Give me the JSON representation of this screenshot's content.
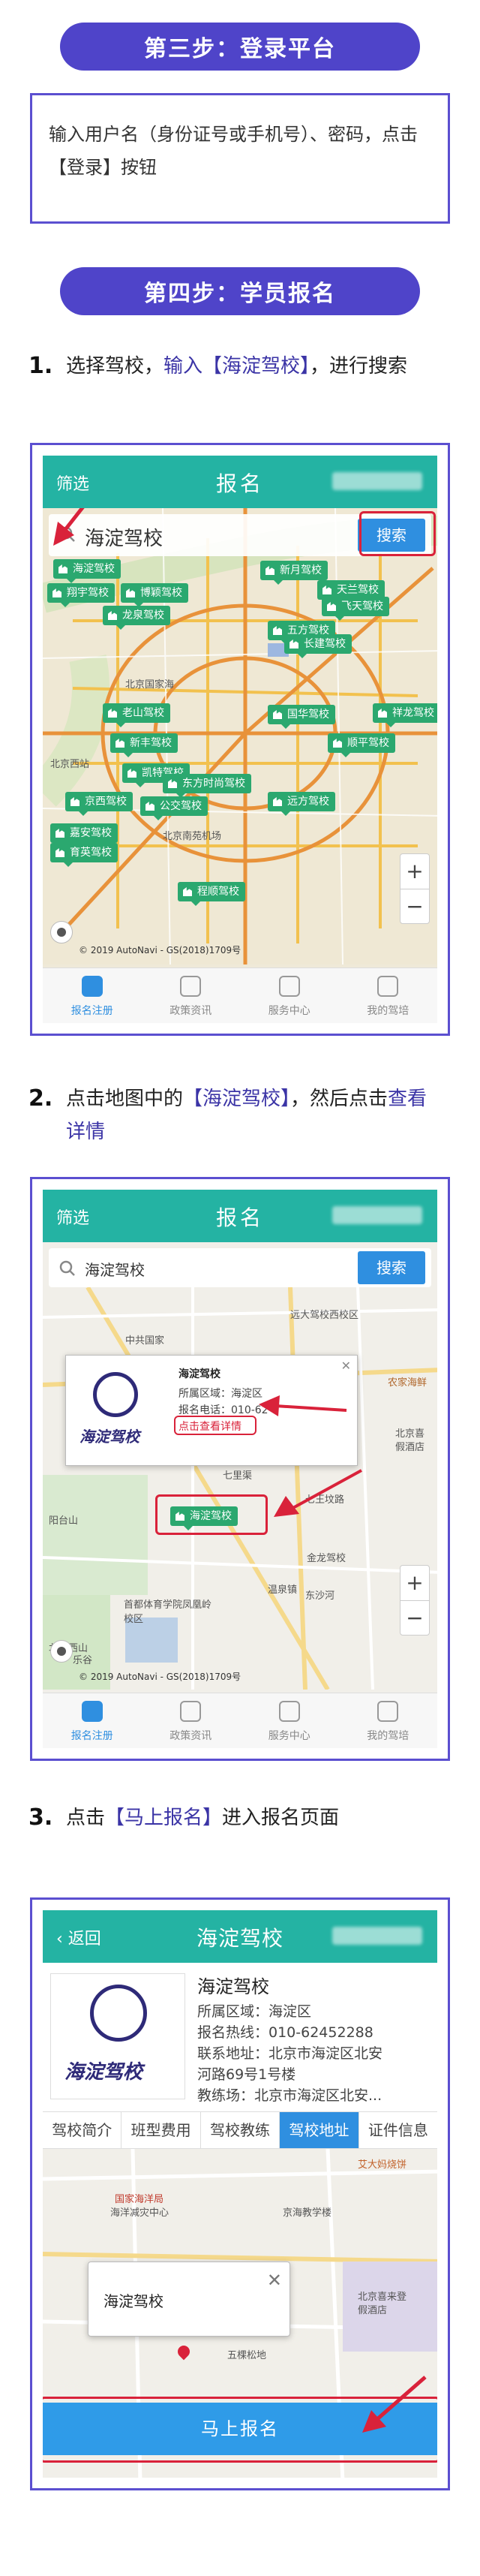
{
  "step3": {
    "title": "第三步：登录平台",
    "instruction": "输入用户名（身份证号或手机号）、密码，点击【登录】按钮"
  },
  "step4": {
    "title": "第四步：学员报名",
    "sub1": {
      "num": "1.",
      "pre": "选择驾校，",
      "hl": "输入【海淀驾校】",
      "post": "，进行搜索"
    },
    "sub2": {
      "num": "2.",
      "pre": "点击地图中的",
      "hl1": "【海淀驾校】",
      "mid": "，然后点击",
      "hl2": "查看详情"
    },
    "sub3": {
      "num": "3.",
      "pre": "点击",
      "hl": "【马上报名】",
      "post": "进入报名页面"
    }
  },
  "app": {
    "filter": "筛选",
    "title": "报名",
    "search_value": "海淀驾校",
    "search_button": "搜索",
    "copyright": "© 2019 AutoNavi - GS(2018)1709号",
    "nav": [
      "报名注册",
      "政策资讯",
      "服务中心",
      "我的驾培"
    ]
  },
  "map1": {
    "tags": [
      "海淀驾校",
      "翔宇驾校",
      "博颖驾校",
      "龙泉驾校",
      "老山驾校",
      "新丰驾校",
      "凯特驾校",
      "公交驾校",
      "东方时尚驾校",
      "京西驾校",
      "嘉安驾校",
      "育英驾校",
      "远方驾校",
      "程顺驾校",
      "新月驾校",
      "天兰驾校",
      "飞天驾校",
      "五方驾校",
      "长建驾校",
      "顺平驾校",
      "国华驾校",
      "祥龙驾校"
    ],
    "labels": [
      "北京国家海",
      "北京西站",
      "北京南苑机场"
    ]
  },
  "map2": {
    "labels": [
      "远大驾校西校区",
      "中共国家",
      "农家海鲜",
      "北京喜",
      "假酒店",
      "七里渠",
      "七王坟路",
      "金龙驾校",
      "首都体育学院凤凰岭校区",
      "北京西山",
      "乐谷",
      "阳台山",
      "温泉镇",
      "东沙河"
    ],
    "popup": {
      "name": "海淀驾校",
      "area": "所属区域：海淀区",
      "phone": "报名电话：010-62",
      "detail": "点击查看详情",
      "logo": "海淀驾校"
    },
    "tag": "海淀驾校"
  },
  "detail": {
    "back": "返回",
    "title": "海淀驾校",
    "name": "海淀驾校",
    "area": "所属区域：海淀区",
    "hotline": "报名热线：010-62452288",
    "address_1": "联系地址：北京市海淀区北安",
    "address_2": "河路69号1号楼",
    "field": "教练场：北京市海淀区北安...",
    "logo": "海淀驾校",
    "tabs": [
      "驾校简介",
      "班型费用",
      "驾校教练",
      "驾校地址",
      "证件信息"
    ],
    "map_labels": [
      "艾大妈烧饼",
      "国家海洋局",
      "海洋减灾中心",
      "京海教学楼",
      "北京喜来登",
      "假酒店",
      "五棵松地"
    ],
    "popup_name": "海淀驾校",
    "signup": "马上报名"
  }
}
